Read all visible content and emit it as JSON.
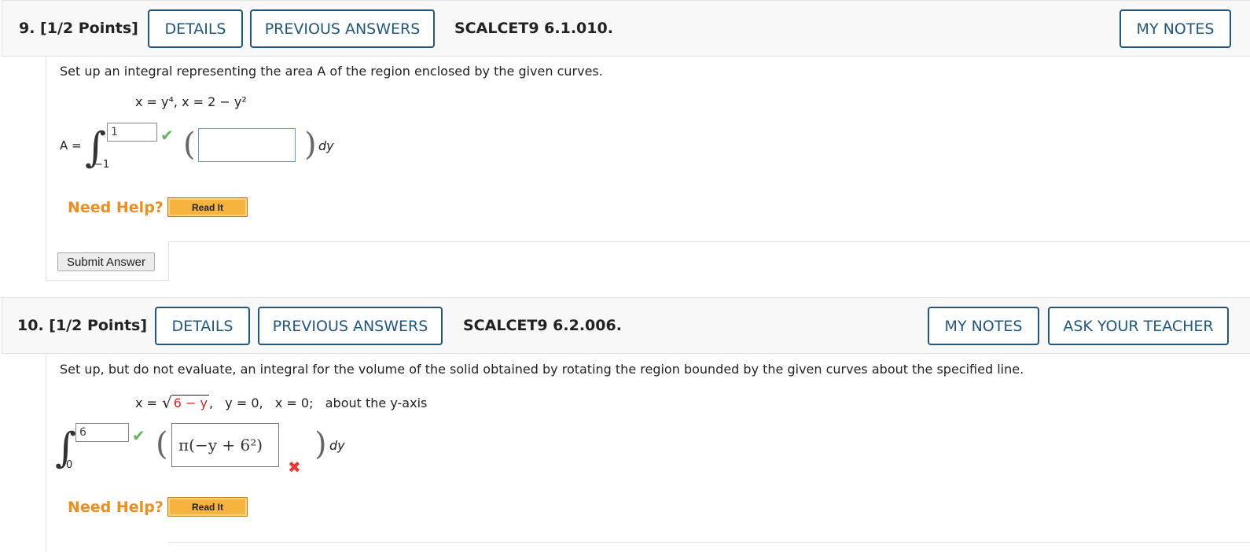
{
  "q9": {
    "number_label": "9.  [1/2 Points]",
    "details_label": "DETAILS",
    "previous_answers_label": "PREVIOUS ANSWERS",
    "code": "SCALCET9 6.1.010.",
    "my_notes_label": "MY NOTES",
    "prompt": "Set up an integral representing the area A of the region enclosed by the given curves.",
    "curves": "x = y⁴,   x = 2 − y²",
    "lhs": "A =",
    "upper_limit": "1",
    "lower_limit": "−1",
    "integrand_value": "",
    "differential": "dy",
    "need_help_label": "Need Help?",
    "read_it_label": "Read It",
    "submit_label": "Submit Answer"
  },
  "q10": {
    "number_label": "10.  [1/2 Points]",
    "details_label": "DETAILS",
    "previous_answers_label": "PREVIOUS ANSWERS",
    "code": "SCALCET9 6.2.006.",
    "my_notes_label": "MY NOTES",
    "ask_teacher_label": "ASK YOUR TEACHER",
    "prompt": "Set up, but do not evaluate, an integral for the volume of the solid obtained by rotating the region bounded by the given curves about the specified line.",
    "curves_prefix": "x =",
    "curves_radicand": "6 − y",
    "curves_suffix": ",   y = 0,   x = 0;   about the y-axis",
    "upper_limit": "6",
    "lower_limit": "0",
    "integrand_value": "π(−y + 6²)",
    "differential": "dy",
    "need_help_label": "Need Help?",
    "read_it_label": "Read It"
  },
  "icons": {
    "correct": "check-icon",
    "incorrect": "x-icon"
  },
  "colors": {
    "header_button_border": "#21577e",
    "need_help": "#f08d1f",
    "read_it_bg": "#f6b33d",
    "correct": "#5cb85c",
    "incorrect": "#e33333",
    "answer_box_border": "#5b9bd5"
  }
}
